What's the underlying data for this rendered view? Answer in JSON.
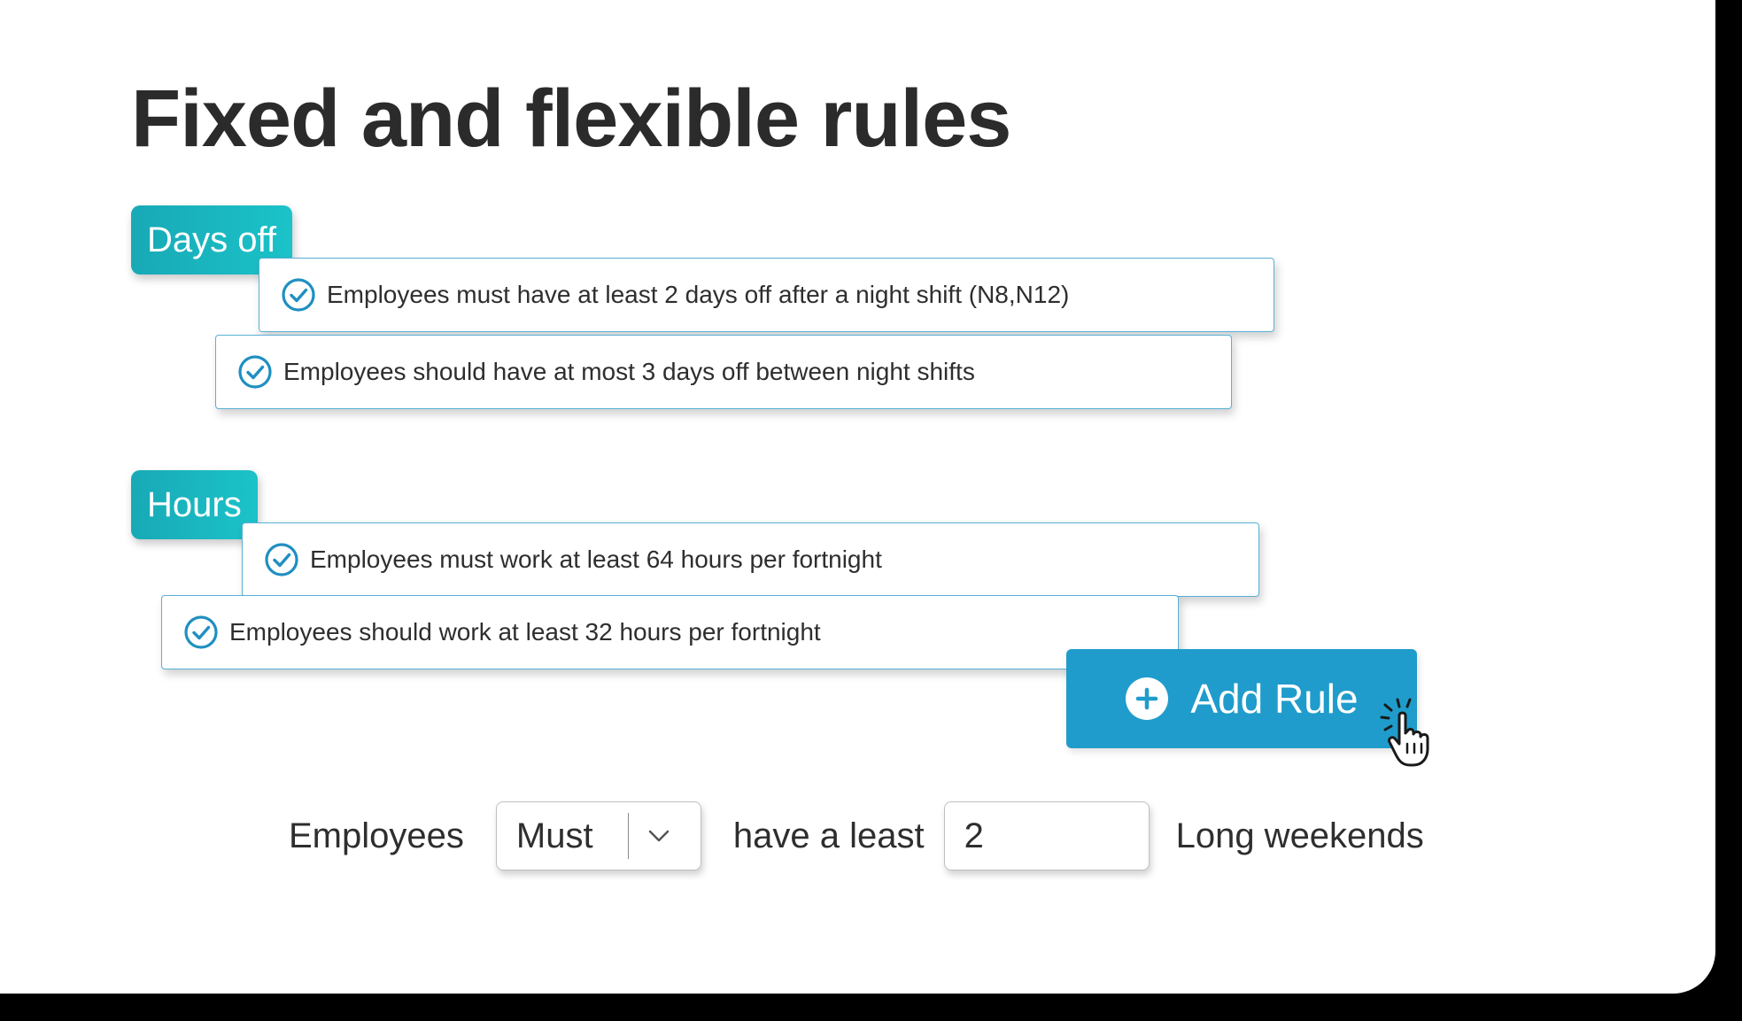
{
  "page_title": "Fixed and flexible rules",
  "sections": [
    {
      "tag": "Days off",
      "rules": [
        "Employees must have at least 2 days off after a night shift (N8,N12)",
        "Employees should have at most 3 days off between night shifts"
      ]
    },
    {
      "tag": "Hours",
      "rules": [
        "Employees must work at least 64 hours per fortnight",
        "Employees should work at least 32 hours per fortnight"
      ]
    }
  ],
  "add_rule_button": {
    "label": "Add Rule",
    "icon": "plus-circle-icon"
  },
  "cursor_icon": "pointer-hand-click-icon",
  "rule_builder": {
    "subject": "Employees",
    "modal_select": {
      "value": "Must",
      "icon": "chevron-down-icon"
    },
    "connector": "have a least",
    "quantity": "2",
    "object": "Long weekends"
  },
  "colors": {
    "tag_gradient_start": "#18a9b6",
    "tag_gradient_end": "#1bc3c9",
    "rule_border": "#59b0d6",
    "check_icon": "#1f8fc0",
    "button": "#1f9ccb",
    "title": "#2b2b2b"
  }
}
